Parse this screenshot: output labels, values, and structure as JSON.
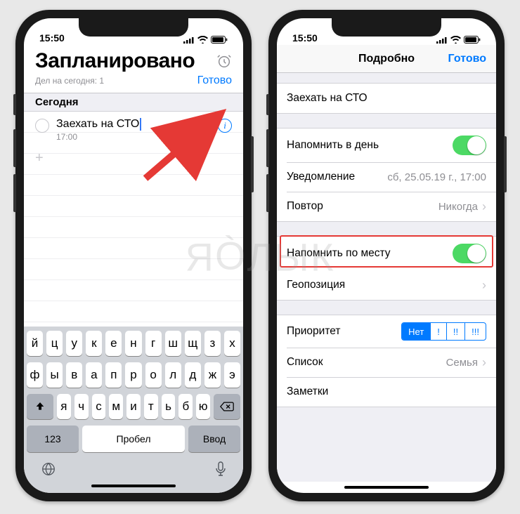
{
  "status": {
    "time": "15:50"
  },
  "left": {
    "title": "Запланировано",
    "subtitle": "Дел на сегодня: 1",
    "done": "Готово",
    "section": "Сегодня",
    "reminder": {
      "title": "Заехать на СТО",
      "time": "17:00"
    },
    "plus": "+",
    "keyboard": {
      "row1": [
        "й",
        "ц",
        "у",
        "к",
        "е",
        "н",
        "г",
        "ш",
        "щ",
        "з",
        "х"
      ],
      "row2": [
        "ф",
        "ы",
        "в",
        "а",
        "п",
        "р",
        "о",
        "л",
        "д",
        "ж",
        "э"
      ],
      "row3": [
        "я",
        "ч",
        "с",
        "м",
        "и",
        "т",
        "ь",
        "б",
        "ю"
      ],
      "num": "123",
      "space": "Пробел",
      "enter": "Ввод"
    }
  },
  "right": {
    "nav_title": "Подробно",
    "nav_done": "Готово",
    "reminder_title": "Заехать на СТО",
    "remind_day": {
      "label": "Напомнить в день",
      "on": true
    },
    "notification": {
      "label": "Уведомление",
      "value": "сб, 25.05.19 г., 17:00"
    },
    "repeat": {
      "label": "Повтор",
      "value": "Никогда"
    },
    "remind_location": {
      "label": "Напомнить по месту",
      "on": true
    },
    "geo": {
      "label": "Геопозиция"
    },
    "priority": {
      "label": "Приоритет",
      "options": [
        "Нет",
        "!",
        "!!",
        "!!!"
      ],
      "selected": 0
    },
    "list": {
      "label": "Список",
      "value": "Семья"
    },
    "notes": {
      "label": "Заметки"
    }
  },
  "watermark": "ЯБЛЫК"
}
